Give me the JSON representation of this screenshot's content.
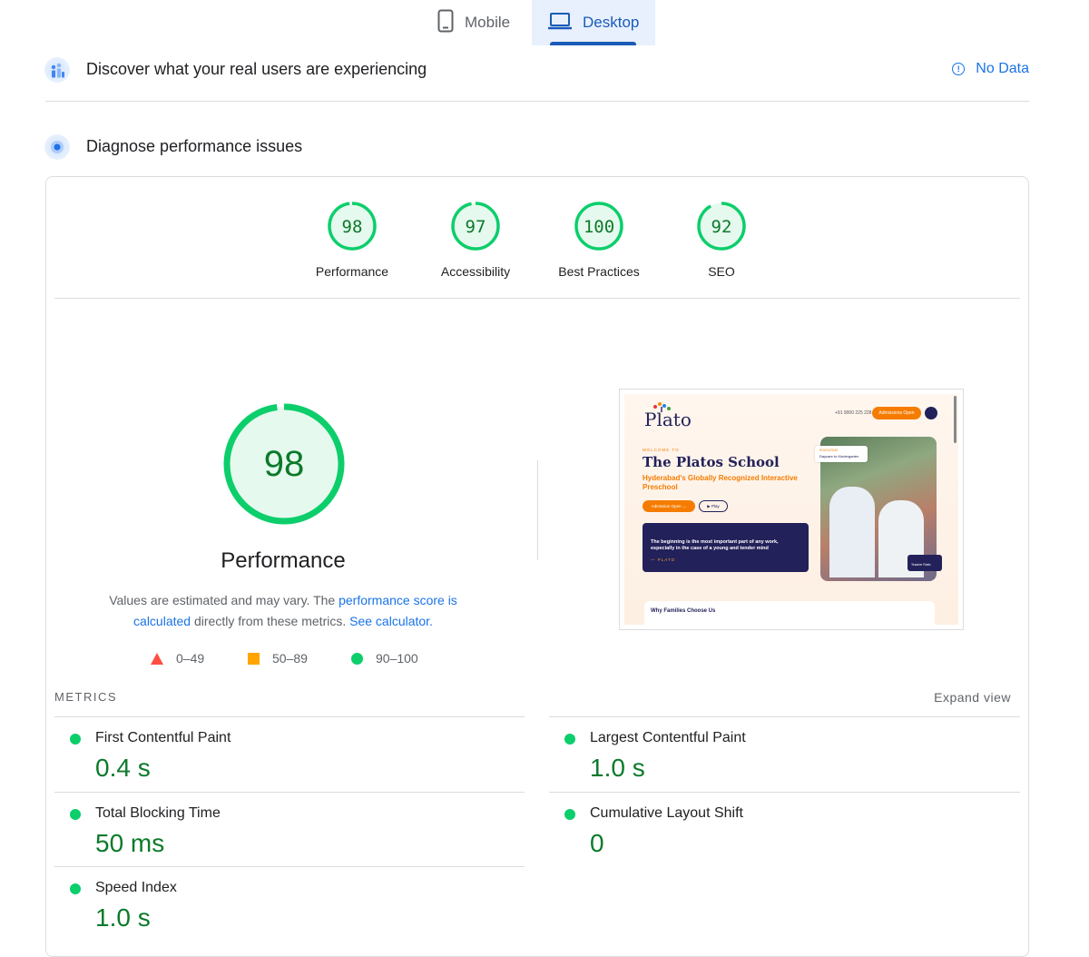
{
  "tabs": [
    {
      "label": "Mobile",
      "icon": "phone-icon",
      "active": false
    },
    {
      "label": "Desktop",
      "icon": "laptop-icon",
      "active": true
    }
  ],
  "field_data": {
    "title": "Discover what your real users are experiencing",
    "status": "No Data"
  },
  "diagnose": {
    "title": "Diagnose performance issues"
  },
  "categories": [
    {
      "label": "Performance",
      "score": "98",
      "fraction": 0.98
    },
    {
      "label": "Accessibility",
      "score": "97",
      "fraction": 0.97
    },
    {
      "label": "Best Practices",
      "score": "100",
      "fraction": 1.0
    },
    {
      "label": "SEO",
      "score": "92",
      "fraction": 0.92
    }
  ],
  "performance": {
    "score": "98",
    "fraction": 0.98,
    "label": "Performance",
    "desc_prefix": "Values are estimated and may vary. The ",
    "desc_link1": "performance score is calculated",
    "desc_middle": " directly from these metrics. ",
    "desc_link2": "See calculator."
  },
  "legend": [
    {
      "range": "0–49",
      "shape": "triangle",
      "color": "#ff4e42"
    },
    {
      "range": "50–89",
      "shape": "square",
      "color": "#ffa400"
    },
    {
      "range": "90–100",
      "shape": "circle",
      "color": "#0cce6b"
    }
  ],
  "screenshot": {
    "logo": "Plato",
    "phone": "+91 9000 225 228",
    "cta": "Admissions Open",
    "kicker": "WELCOME TO",
    "headline": "The Platos School",
    "subhead": "Hyderabad's Globally Recognized Interactive Preschool",
    "btn_primary": "Admission Open →",
    "btn_secondary": "▶ Play",
    "quote": "The beginning is the most important part of any work, especially in the case of a young and tender mind",
    "quote_author": "— PLATO",
    "badge_top_kicker": "EDUCATING",
    "badge_top": "Daycare to Kindergarten",
    "badge_bottom": "Teacher Ratio",
    "footer": "Why Families Choose Us"
  },
  "metrics": {
    "title": "METRICS",
    "expand_label": "Expand view",
    "items": [
      {
        "name": "First Contentful Paint",
        "value": "0.4 s"
      },
      {
        "name": "Largest Contentful Paint",
        "value": "1.0 s"
      },
      {
        "name": "Total Blocking Time",
        "value": "50 ms"
      },
      {
        "name": "Cumulative Layout Shift",
        "value": "0"
      },
      {
        "name": "Speed Index",
        "value": "1.0 s"
      }
    ]
  },
  "colors": {
    "pass": "#0cce6b",
    "pass_text": "#0c7a2a",
    "pass_fill": "#e6f9ee",
    "link": "#1a73e8",
    "active_tab": "#1a5bb8"
  }
}
